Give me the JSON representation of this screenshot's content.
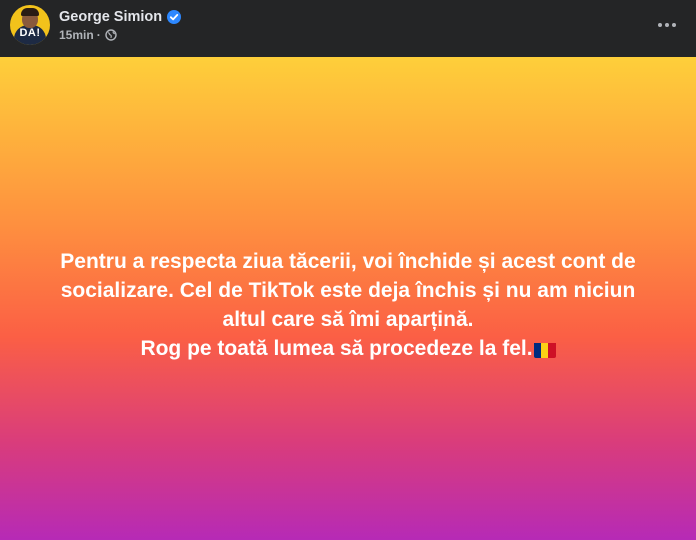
{
  "author": {
    "name": "George Simion",
    "avatar_text": "DA!"
  },
  "meta": {
    "time": "15min",
    "separator": "·",
    "audience_icon": "globe-icon"
  },
  "header_actions": {
    "more_icon": "ellipsis-horizontal-icon"
  },
  "post": {
    "lines": [
      "Pentru a respecta ziua tăcerii, voi închide și acest cont de",
      "socializare. Cel de TikTok este deja închis și nu am niciun",
      "altul care să îmi aparțină.",
      "Rog pe toată lumea să procedeze la fel."
    ],
    "emoji": "romania-flag",
    "background_gradient": [
      "#fecf3a",
      "#fe8f3f",
      "#fb5f45",
      "#d93c7c",
      "#b62ab6"
    ]
  },
  "colors": {
    "header_bg": "#242526",
    "name_text": "#e4e6eb",
    "meta_text": "#b0b3b8",
    "verified_badge": "#2d88ff",
    "flag": [
      "#002b7f",
      "#fcd116",
      "#ce1126"
    ]
  }
}
